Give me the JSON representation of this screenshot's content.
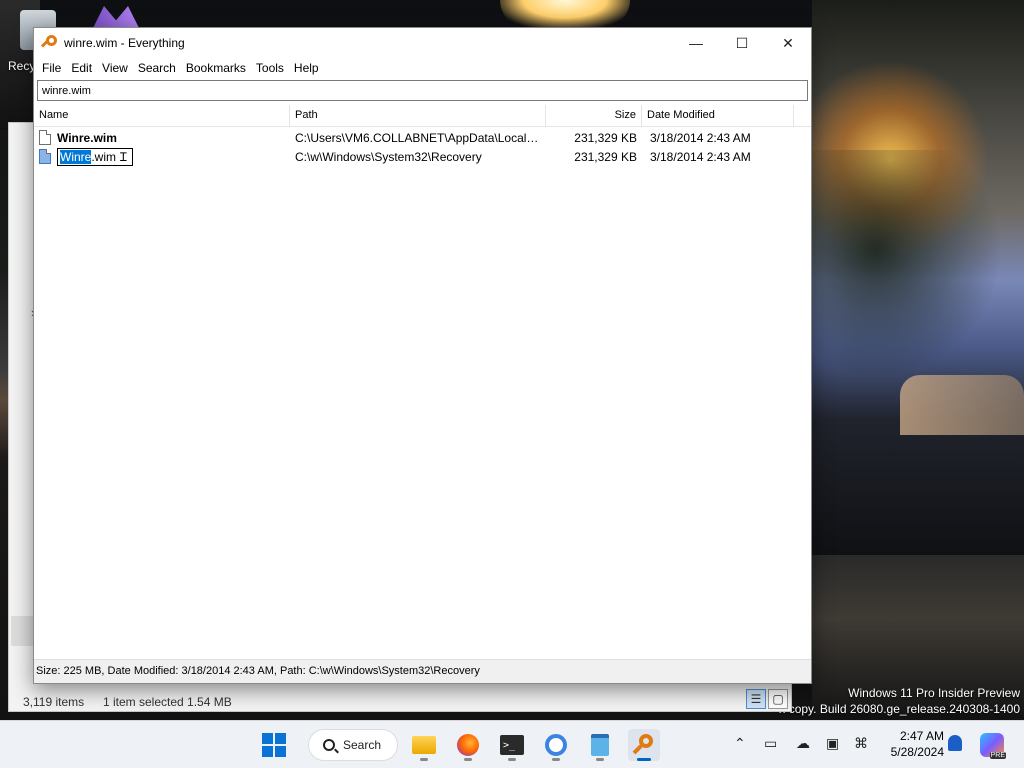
{
  "desktop": {
    "recycle_label": "Recy",
    "watermark_line1": "Windows 11 Pro Insider Preview",
    "watermark_line2": "n copy. Build 26080.ge_release.240308-1400"
  },
  "explorer": {
    "status_items": "3,119 items",
    "status_selected": "1 item selected  1.54 MB"
  },
  "everything": {
    "title": "winre.wim - Everything",
    "menu": [
      "File",
      "Edit",
      "View",
      "Search",
      "Bookmarks",
      "Tools",
      "Help"
    ],
    "search_value": "winre.wim",
    "columns": {
      "name": "Name",
      "path": "Path",
      "size": "Size",
      "date": "Date Modified"
    },
    "rows": [
      {
        "name": "Winre.wim",
        "path": "C:\\Users\\VM6.COLLABNET\\AppData\\Local\\T...",
        "size": "231,329 KB",
        "date": "3/18/2014 2:43 AM"
      },
      {
        "name_selected_part": "Winre",
        "name_rest": ".wim",
        "path": "C:\\w\\Windows\\System32\\Recovery",
        "size": "231,329 KB",
        "date": "3/18/2014 2:43 AM"
      }
    ],
    "status": "Size: 225 MB, Date Modified: 3/18/2014 2:43 AM, Path: C:\\w\\Windows\\System32\\Recovery"
  },
  "taskbar": {
    "search_label": "Search",
    "time": "2:47 AM",
    "date": "5/28/2024",
    "copilot_badge": "PRE"
  },
  "icons": {
    "start": "windows-logo",
    "explorer": "folder",
    "firefox": "firefox",
    "terminal": "terminal",
    "chrome": "chrome",
    "notepad": "notepad",
    "everything": "magnifier"
  }
}
